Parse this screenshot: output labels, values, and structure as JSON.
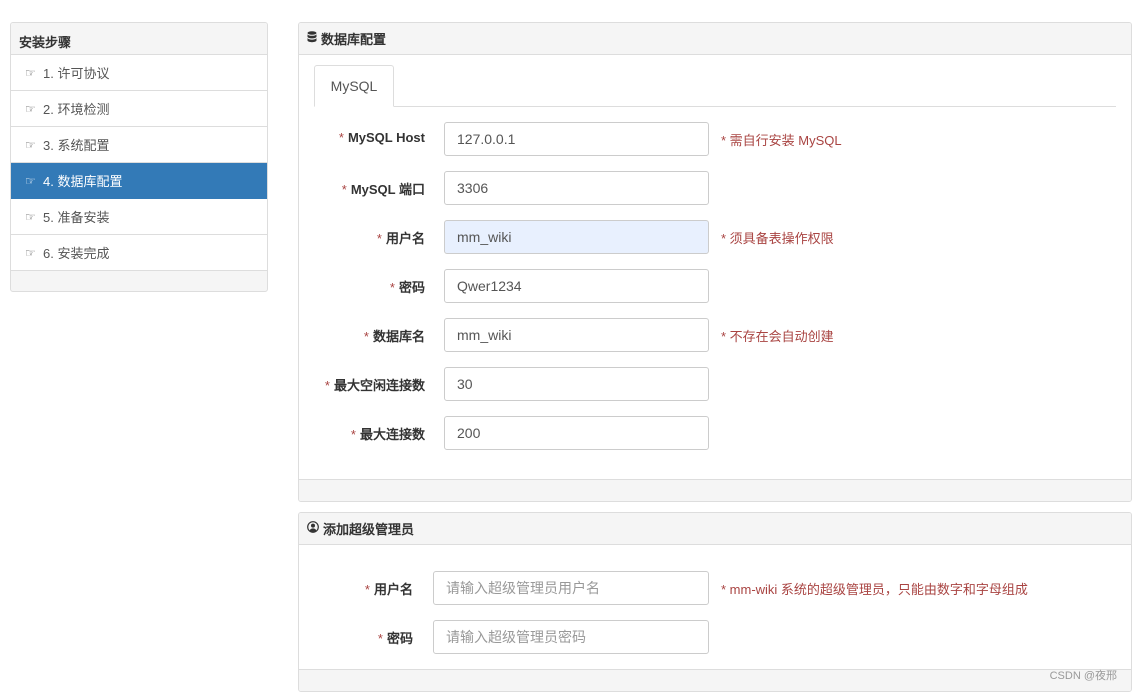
{
  "sidebar": {
    "title": "安装步骤",
    "items": [
      {
        "label": "1. 许可协议",
        "active": false
      },
      {
        "label": "2. 环境检测",
        "active": false
      },
      {
        "label": "3. 系统配置",
        "active": false
      },
      {
        "label": "4. 数据库配置",
        "active": true
      },
      {
        "label": "5. 准备安装",
        "active": false
      },
      {
        "label": "6. 安装完成",
        "active": false
      }
    ],
    "icon": "hand-point-right-icon"
  },
  "db_panel": {
    "title": "数据库配置",
    "icon": "database-icon",
    "tab": "MySQL",
    "fields": [
      {
        "label": "MySQL Host",
        "value": "127.0.0.1",
        "help": "* 需自行安装 MySQL"
      },
      {
        "label": "MySQL 端口",
        "value": "3306",
        "help": ""
      },
      {
        "label": "用户名",
        "value": "mm_wiki",
        "help": "* 须具备表操作权限"
      },
      {
        "label": "密码",
        "value": "Qwer1234",
        "help": ""
      },
      {
        "label": "数据库名",
        "value": "mm_wiki",
        "help": "* 不存在会自动创建"
      },
      {
        "label": "最大空闲连接数",
        "value": "30",
        "help": ""
      },
      {
        "label": "最大连接数",
        "value": "200",
        "help": ""
      }
    ]
  },
  "admin_panel": {
    "title": "添加超级管理员",
    "icon": "user-circle-icon",
    "fields": [
      {
        "label": "用户名",
        "value": "",
        "placeholder": "请输入超级管理员用户名",
        "help": "* mm-wiki 系统的超级管理员，只能由数字和字母组成"
      },
      {
        "label": "密码",
        "value": "",
        "placeholder": "请输入超级管理员密码",
        "help": ""
      }
    ]
  },
  "required_mark": "*",
  "watermark": "CSDN @夜邢",
  "colors": {
    "accent": "#337ab7",
    "required": "#a94442",
    "autofill": "#e8f0fe"
  }
}
